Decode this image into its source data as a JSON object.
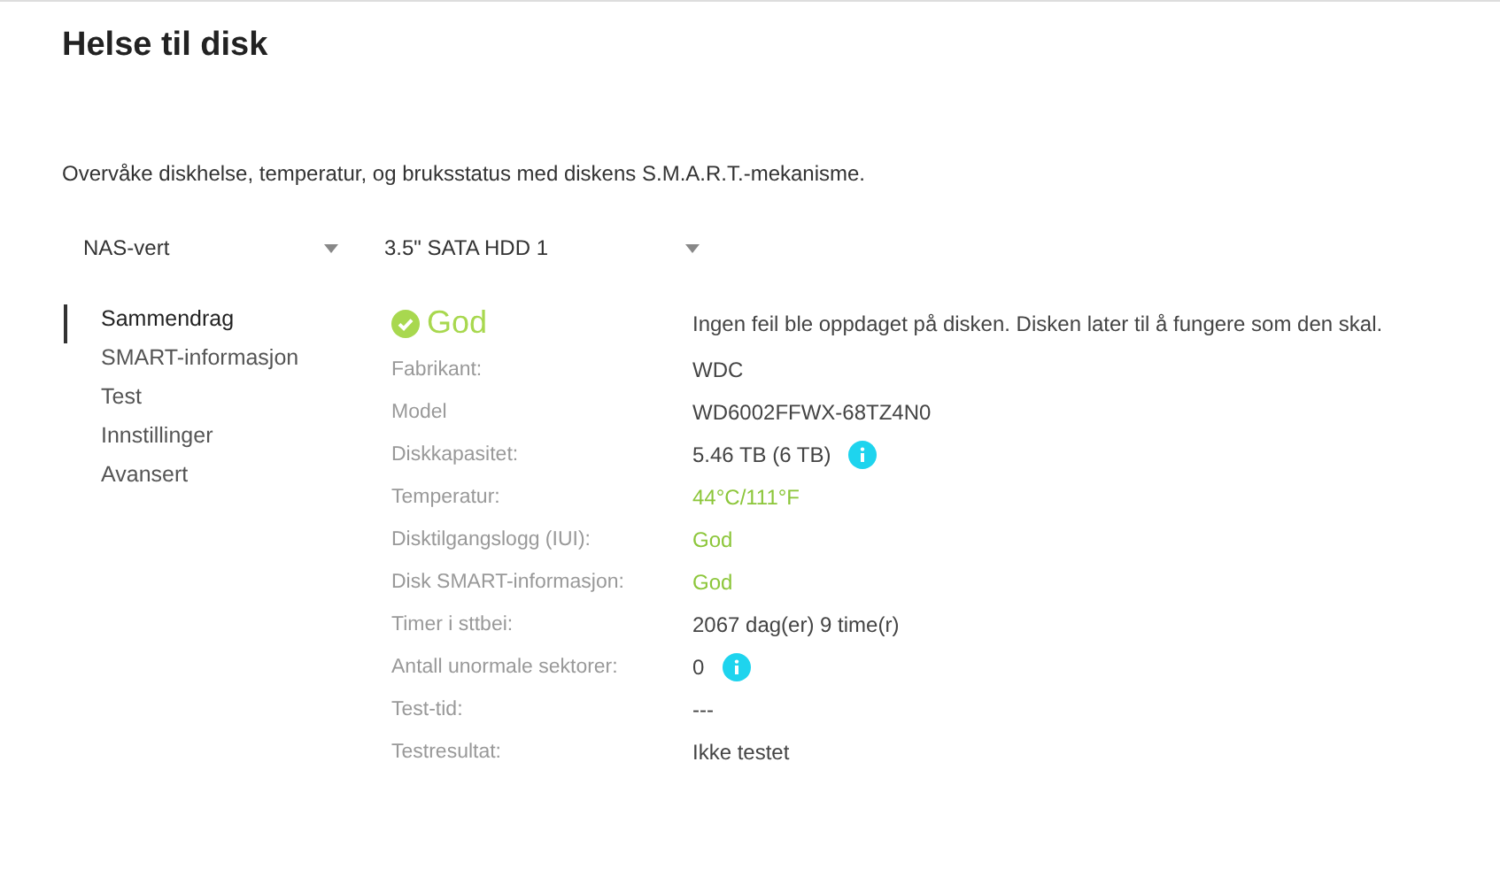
{
  "title": "Helse til disk",
  "description": "Overvåke diskhelse, temperatur, og bruksstatus med diskens S.M.A.R.T.-mekanisme.",
  "selectors": [
    {
      "value": "NAS-vert"
    },
    {
      "value": "3.5\" SATA HDD 1"
    }
  ],
  "nav": [
    {
      "label": "Sammendrag",
      "selected": true
    },
    {
      "label": "SMART-informasjon",
      "selected": false
    },
    {
      "label": "Test",
      "selected": false
    },
    {
      "label": "Innstillinger",
      "selected": false
    },
    {
      "label": "Avansert",
      "selected": false
    }
  ],
  "status": {
    "label": "God",
    "message": "Ingen feil ble oppdaget på disken. Disken later til å fungere som den skal."
  },
  "details": [
    {
      "label": "Fabrikant:",
      "value": "WDC",
      "kind": "plain"
    },
    {
      "label": "Model",
      "value": "WD6002FFWX-68TZ4N0",
      "kind": "plain"
    },
    {
      "label": "Diskkapasitet:",
      "value": "5.46 TB (6 TB)",
      "kind": "info"
    },
    {
      "label": "Temperatur:",
      "value": "44°C/111°F",
      "kind": "good"
    },
    {
      "label": "Disktilgangslogg (IUI):",
      "value": "God",
      "kind": "good"
    },
    {
      "label": "Disk SMART-informasjon:",
      "value": "God",
      "kind": "good"
    },
    {
      "label": "Timer i sttbei:",
      "value": "2067 dag(er) 9 time(r)",
      "kind": "plain"
    },
    {
      "label": "Antall unormale sektorer:",
      "value": "0",
      "kind": "info"
    },
    {
      "label": "Test-tid:",
      "value": "---",
      "kind": "plain"
    },
    {
      "label": "Testresultat:",
      "value": "Ikke testet",
      "kind": "plain"
    }
  ]
}
